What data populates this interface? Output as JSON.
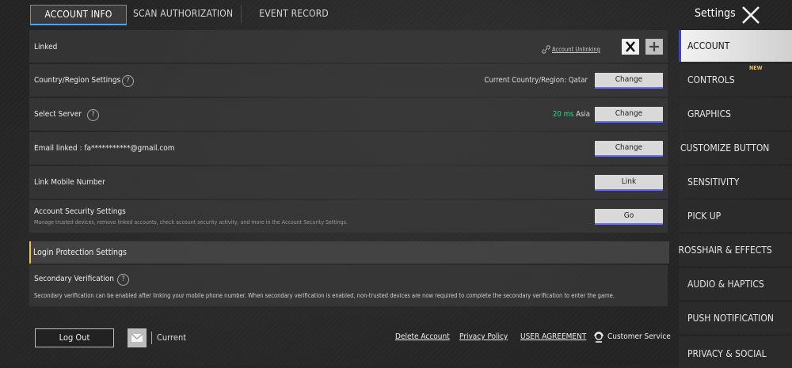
{
  "tabs": [
    "ACCOUNT INFO",
    "SCAN AUTHORIZATION",
    "EVENT RECORD"
  ],
  "sidebar": {
    "title": "Settings",
    "items": [
      {
        "label": "ACCOUNT"
      },
      {
        "label": "CONTROLS",
        "badge": "NEW"
      },
      {
        "label": "GRAPHICS"
      },
      {
        "label": "CUSTOMIZE BUTTON"
      },
      {
        "label": "SENSITIVITY"
      },
      {
        "label": "PICK UP"
      },
      {
        "label": "CROSSHAIR & EFFECTS"
      },
      {
        "label": "AUDIO & HAPTICS"
      },
      {
        "label": "PUSH NOTIFICATION"
      },
      {
        "label": "PRIVACY & SOCIAL"
      }
    ]
  },
  "linked": {
    "label": "Linked",
    "unlink": "Account Unlinking"
  },
  "country": {
    "label": "Country/Region Settings",
    "current": "Current Country/Region: Qatar",
    "button": "Change"
  },
  "server": {
    "label": "Select Server",
    "ping": "20 ms",
    "region": "Asia",
    "button": "Change"
  },
  "email": {
    "label": "Email linked : fa***********@gmail.com",
    "button": "Change"
  },
  "mobile": {
    "label": "Link Mobile Number",
    "button": "Link"
  },
  "security": {
    "label": "Account Security Settings",
    "desc": "Manage trusted devices, remove linked accounts, check account security activity, and more in the Account Security Settings.",
    "button": "Go"
  },
  "login_protection": {
    "label": "Login Protection Settings"
  },
  "secondary": {
    "label": "Secondary Verification",
    "desc": "Secondary verification can be enabled after linking your mobile phone number. When secondary verification is enabled, non-trusted devices are now required to complete the secondary verification to enter the game."
  },
  "footer": {
    "logout": "Log Out",
    "current": "Current",
    "delete_account": "Delete Account",
    "privacy_policy": "Privacy Policy",
    "user_agreement": "USER AGREEMENT",
    "customer_service": "Customer Service"
  }
}
